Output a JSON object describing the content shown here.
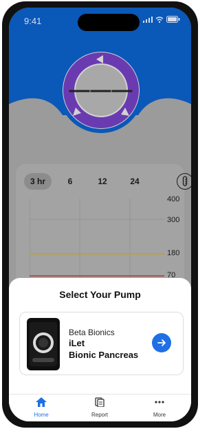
{
  "status_bar": {
    "time": "9:41"
  },
  "glucose": {
    "reading": "———"
  },
  "range_tabs": [
    {
      "label": "3 hr",
      "active": true
    },
    {
      "label": "6",
      "active": false
    },
    {
      "label": "12",
      "active": false
    },
    {
      "label": "24",
      "active": false
    }
  ],
  "chart": {
    "y_ticks": [
      "400",
      "300",
      "180",
      "70"
    ],
    "high_line_color": "#c8a020",
    "low_line_color": "#b03a2e"
  },
  "sheet": {
    "title": "Select Your Pump",
    "pump": {
      "brand": "Beta Bionics",
      "name": "iLet",
      "model": "Bionic Pancreas"
    }
  },
  "tabbar": {
    "items": [
      {
        "label": "Home",
        "icon": "home-icon",
        "active": true
      },
      {
        "label": "Report",
        "icon": "report-icon",
        "active": false
      },
      {
        "label": "More",
        "icon": "more-icon",
        "active": false
      }
    ]
  },
  "colors": {
    "brand_blue": "#0a58b8",
    "ring_purple": "#6a3bb0",
    "accent": "#1f6fe5"
  }
}
